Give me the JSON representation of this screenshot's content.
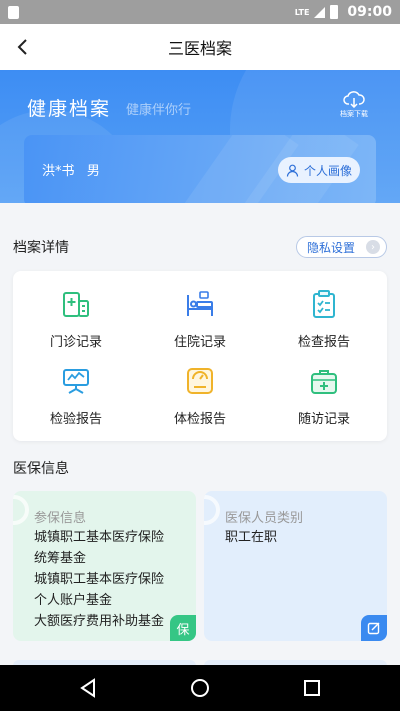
{
  "status": {
    "network": "LTE",
    "time": "09:00"
  },
  "app_bar": {
    "title": "三医档案"
  },
  "hero": {
    "title": "健康档案",
    "subtitle": "健康伴你行",
    "download_label": "档案下载"
  },
  "patient_card": {
    "name": "洪*书",
    "gender": "男",
    "portrait_label": "个人画像"
  },
  "records": {
    "title": "档案详情",
    "privacy_label": "隐私设置",
    "items": [
      {
        "label": "门诊记录",
        "icon": "outpatient-building-icon",
        "color": "#2fbf7e"
      },
      {
        "label": "住院记录",
        "icon": "hospital-bed-icon",
        "color": "#3a7de8"
      },
      {
        "label": "检查报告",
        "icon": "clipboard-check-icon",
        "color": "#2fb5d0"
      },
      {
        "label": "检验报告",
        "icon": "lab-board-icon",
        "color": "#2a9de0"
      },
      {
        "label": "体检报告",
        "icon": "scale-icon",
        "color": "#f0b32a"
      },
      {
        "label": "随访记录",
        "icon": "medical-kit-icon",
        "color": "#2fbf7e"
      }
    ]
  },
  "insurance": {
    "title": "医保信息",
    "info_card": {
      "heading": "参保信息",
      "lines": [
        "城镇职工基本医疗保险",
        "统筹基金",
        "城镇职工基本医疗保险",
        "个人账户基金",
        "大额医疗费用补助基金"
      ],
      "badge": "保"
    },
    "category_card": {
      "heading": "医保人员类别",
      "lines": [
        "职工在职"
      ]
    }
  }
}
